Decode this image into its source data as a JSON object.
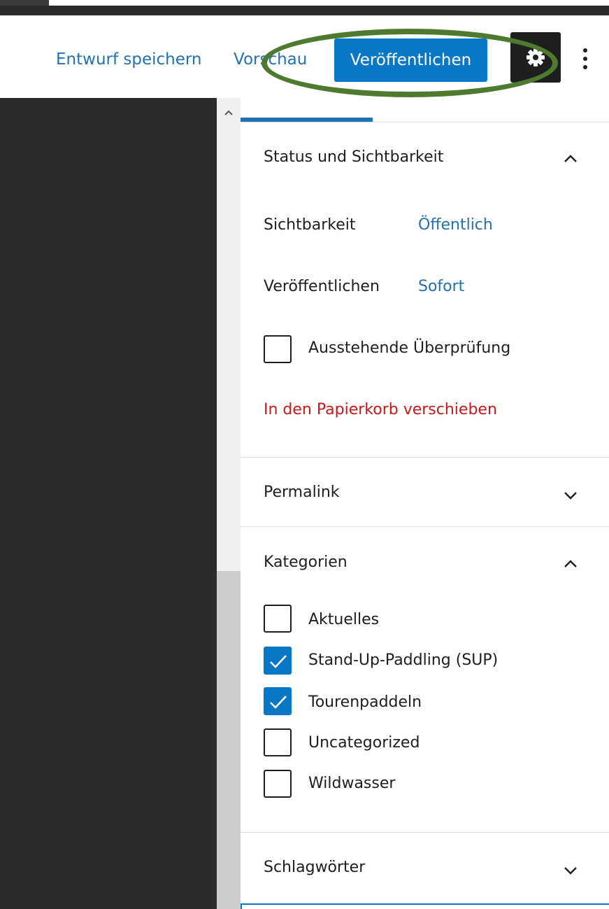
{
  "toolbar": {
    "save_draft_label": "Entwurf speichern",
    "preview_label": "Vorschau",
    "publish_label": "Veröffentlichen",
    "settings_icon": "gear-icon",
    "more_icon": "vertical-ellipsis-icon",
    "highlight_color": "#4e7a2f"
  },
  "status_panel": {
    "title": "Status und Sichtbarkeit",
    "expanded": true,
    "visibility_label": "Sichtbarkeit",
    "visibility_value": "Öffentlich",
    "publish_label": "Veröffentlichen",
    "publish_value": "Sofort",
    "pending_review_label": "Ausstehende Überprüfung",
    "pending_review_checked": false,
    "trash_label": "In den Papierkorb verschieben"
  },
  "permalink_panel": {
    "title": "Permalink",
    "expanded": false
  },
  "categories_panel": {
    "title": "Kategorien",
    "expanded": true,
    "items": [
      {
        "label": "Aktuelles",
        "checked": false
      },
      {
        "label": "Stand-Up-Paddling (SUP)",
        "checked": true
      },
      {
        "label": "Tourenpaddeln",
        "checked": true
      },
      {
        "label": "Uncategorized",
        "checked": false
      },
      {
        "label": "Wildwasser",
        "checked": false
      }
    ]
  },
  "tags_panel": {
    "title": "Schlagwörter",
    "expanded": false
  },
  "colors": {
    "accent": "#0878c6",
    "link": "#2271b1",
    "danger": "#cc1818"
  }
}
